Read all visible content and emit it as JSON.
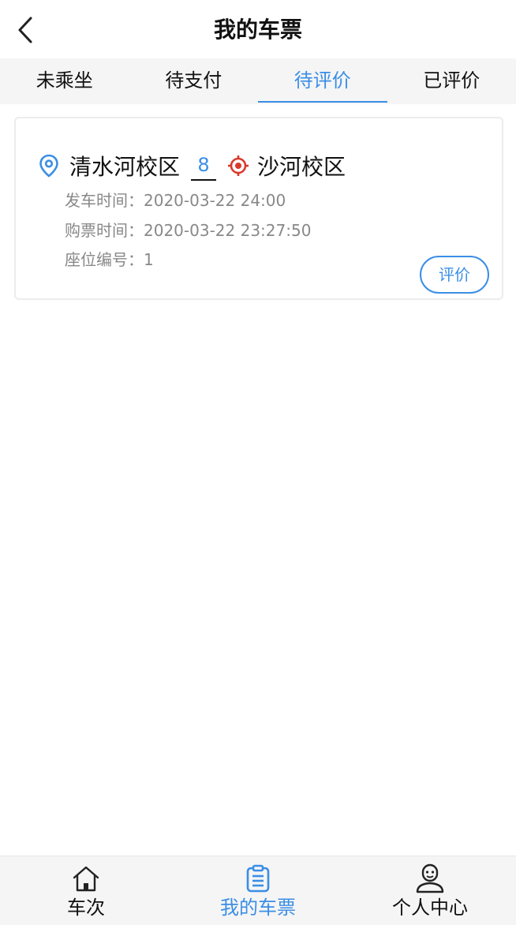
{
  "header": {
    "title": "我的车票",
    "back_icon": "chevron-left-icon"
  },
  "tabs": [
    {
      "label": "未乘坐",
      "active": false
    },
    {
      "label": "待支付",
      "active": false
    },
    {
      "label": "待评价",
      "active": true
    },
    {
      "label": "已评价",
      "active": false
    }
  ],
  "ticket": {
    "from": "清水河校区",
    "bus_number": "8",
    "to": "沙河校区",
    "departure_label": "发车时间：",
    "departure_time": "2020-03-22 24:00",
    "purchase_label": "购票时间：",
    "purchase_time": "2020-03-22 23:27:50",
    "seat_label": "座位编号：",
    "seat_number": "1",
    "action_label": "评价"
  },
  "bottom_nav": [
    {
      "label": "车次",
      "icon": "home-icon",
      "active": false
    },
    {
      "label": "我的车票",
      "icon": "clipboard-icon",
      "active": true
    },
    {
      "label": "个人中心",
      "icon": "user-icon",
      "active": false
    }
  ],
  "colors": {
    "accent": "#3a8ee6",
    "destination": "#d9392b",
    "muted_text": "#888888",
    "tab_bg": "#f5f5f5"
  }
}
